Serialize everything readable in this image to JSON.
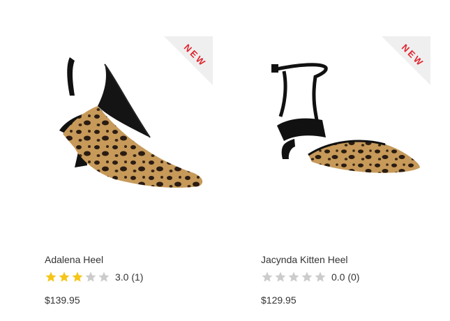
{
  "products": [
    {
      "name": "Adalena Heel",
      "badge": "NEW",
      "rating": 3.0,
      "rating_text": "3.0 (1)",
      "price": "$139.95",
      "image_icon": "leopard-slingback-pump",
      "colors": {
        "primary": "#c79a5a",
        "spots": "#2a1c12",
        "trim": "#111111"
      }
    },
    {
      "name": "Jacynda Kitten Heel",
      "badge": "NEW",
      "rating": 0.0,
      "rating_text": "0.0 (0)",
      "price": "$129.95",
      "image_icon": "leopard-ankle-strap-kitten-heel",
      "colors": {
        "primary": "#c79a5a",
        "spots": "#2a1c12",
        "trim": "#111111"
      }
    }
  ],
  "star_colors": {
    "filled": "#f5c518",
    "empty": "#cccccc"
  },
  "badge_color": "#e0242d"
}
